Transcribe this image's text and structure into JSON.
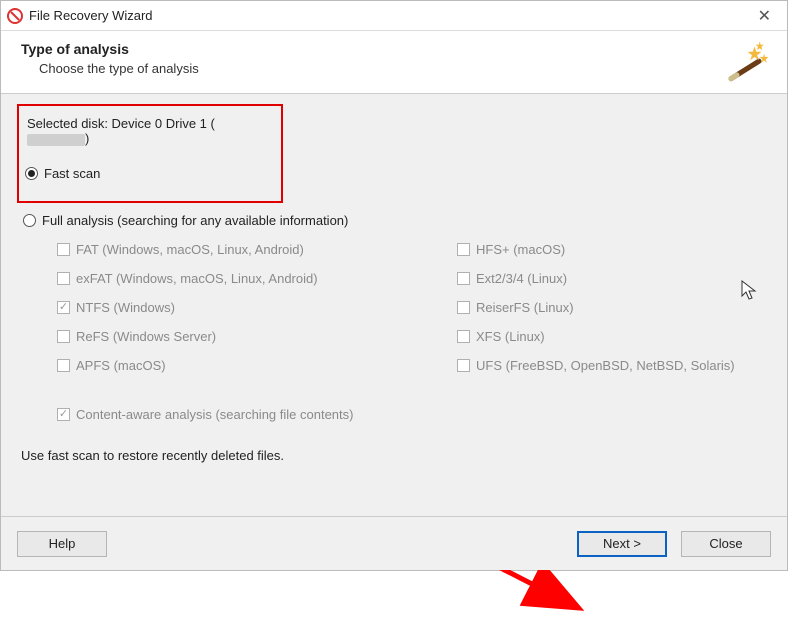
{
  "titlebar": {
    "title": "File Recovery Wizard"
  },
  "header": {
    "heading": "Type of analysis",
    "subheading": "Choose the type of analysis"
  },
  "selected_disk": {
    "prefix": "Selected disk: ",
    "value": "Device 0 Drive 1 (",
    "suffix": ")"
  },
  "scan": {
    "fast_label": "Fast scan",
    "full_label": "Full analysis (searching for any available information)",
    "selected": "fast"
  },
  "filesystems": {
    "left": [
      {
        "label": "FAT (Windows, macOS, Linux, Android)",
        "checked": false
      },
      {
        "label": "exFAT (Windows, macOS, Linux, Android)",
        "checked": false
      },
      {
        "label": "NTFS (Windows)",
        "checked": true
      },
      {
        "label": "ReFS (Windows Server)",
        "checked": false
      },
      {
        "label": "APFS (macOS)",
        "checked": false
      }
    ],
    "right": [
      {
        "label": "HFS+ (macOS)",
        "checked": false
      },
      {
        "label": "Ext2/3/4 (Linux)",
        "checked": false
      },
      {
        "label": "ReiserFS (Linux)",
        "checked": false
      },
      {
        "label": "XFS (Linux)",
        "checked": false
      },
      {
        "label": "UFS (FreeBSD, OpenBSD, NetBSD, Solaris)",
        "checked": false
      }
    ]
  },
  "content_aware": {
    "label": "Content-aware analysis (searching file contents)",
    "checked": true
  },
  "hint": "Use fast scan to restore recently deleted files.",
  "buttons": {
    "help": "Help",
    "next": "Next >",
    "close": "Close"
  }
}
